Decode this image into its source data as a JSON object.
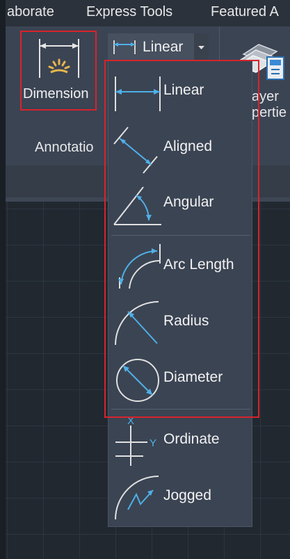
{
  "ribbon_tabs": [
    "aborate",
    "Express Tools",
    "Featured A"
  ],
  "dimension_button": {
    "label": "Dimension"
  },
  "panel": {
    "label": "Annotatio"
  },
  "linear_button": {
    "label": "Linear"
  },
  "layer_properties": {
    "line1": "ayer",
    "line2": "pertie"
  },
  "dropdown_items": [
    {
      "label": "Linear",
      "icon": "linear-dimension-icon"
    },
    {
      "label": "Aligned",
      "icon": "aligned-dimension-icon"
    },
    {
      "label": "Angular",
      "icon": "angular-dimension-icon"
    },
    {
      "label": "Arc Length",
      "icon": "arc-length-icon"
    },
    {
      "label": "Radius",
      "icon": "radius-icon"
    },
    {
      "label": "Diameter",
      "icon": "diameter-icon"
    },
    {
      "label": "Ordinate",
      "icon": "ordinate-icon"
    },
    {
      "label": "Jogged",
      "icon": "jogged-icon"
    }
  ],
  "colors": {
    "highlight_border": "#d8232a",
    "icon_blue": "#4fb0e8",
    "panel_bg": "#3b4453",
    "canvas_bg": "#212830"
  }
}
